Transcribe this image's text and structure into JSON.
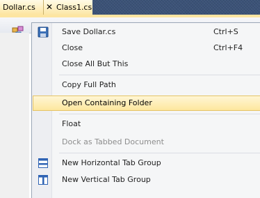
{
  "tabs": {
    "active": "Dollar.cs",
    "close_glyph": "✕",
    "inactive": "Class1.cs"
  },
  "menu": {
    "items": [
      {
        "label": "Save Dollar.cs",
        "shortcut": "Ctrl+S",
        "icon": "save-icon",
        "enabled": true
      },
      {
        "label": "Close",
        "shortcut": "Ctrl+F4",
        "enabled": true
      },
      {
        "label": "Close All But This",
        "enabled": true
      },
      {
        "label": "Copy Full Path",
        "enabled": true
      },
      {
        "label": "Open Containing Folder",
        "enabled": true,
        "highlighted": true
      },
      {
        "label": "Float",
        "enabled": true
      },
      {
        "label": "Dock as Tabbed Document",
        "enabled": false
      },
      {
        "label": "New Horizontal Tab Group",
        "icon": "horizontal-tab-group-icon",
        "enabled": true
      },
      {
        "label": "New Vertical Tab Group",
        "icon": "vertical-tab-group-icon",
        "enabled": true
      }
    ]
  },
  "colors": {
    "background": "#3b5277",
    "tab_active": "#fde5a1",
    "menu_background": "#f5f6f7",
    "menu_highlight": "#fde79e",
    "menu_highlight_border": "#e5c365",
    "disabled_text": "#8d8d8d"
  }
}
